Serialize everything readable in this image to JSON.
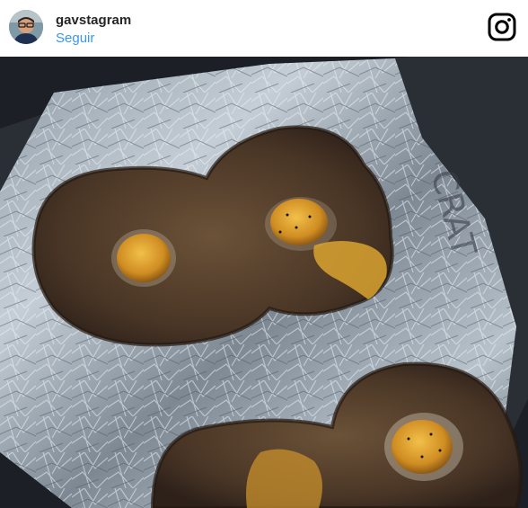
{
  "post": {
    "username": "gavstagram",
    "follow_label": "Seguir",
    "icons": {
      "avatar": "profile-avatar",
      "brand": "instagram-glyph-icon"
    },
    "photo": {
      "subject": "four toasts with fried eggs on crumpled aluminium foil tray"
    }
  },
  "colors": {
    "username": "#262626",
    "follow": "#3897f0",
    "background": "#ffffff"
  }
}
